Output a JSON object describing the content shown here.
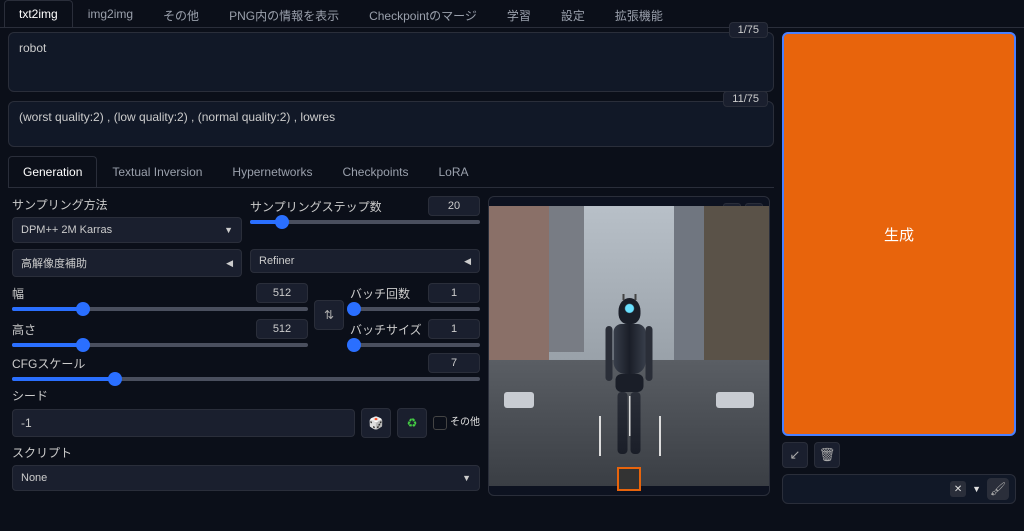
{
  "topTabs": [
    "txt2img",
    "img2img",
    "その他",
    "PNG内の情報を表示",
    "Checkpointのマージ",
    "学習",
    "設定",
    "拡張機能"
  ],
  "activeTopTab": 0,
  "prompt": {
    "text": "robot",
    "counter": "1/75"
  },
  "negPrompt": {
    "text": "(worst quality:2) , (low quality:2) , (normal quality:2) , lowres",
    "counter": "11/75"
  },
  "generateLabel": "生成",
  "subTabs": [
    "Generation",
    "Textual Inversion",
    "Hypernetworks",
    "Checkpoints",
    "LoRA"
  ],
  "activeSubTab": 0,
  "sampling": {
    "methodLabel": "サンプリング方法",
    "methodValue": "DPM++ 2M Karras",
    "stepsLabel": "サンプリングステップ数",
    "stepsValue": "20",
    "stepsPct": 14
  },
  "hires": {
    "label": "高解像度補助"
  },
  "refiner": {
    "label": "Refiner"
  },
  "width": {
    "label": "幅",
    "value": "512",
    "pct": 24
  },
  "height": {
    "label": "高さ",
    "value": "512",
    "pct": 24
  },
  "batchCount": {
    "label": "バッチ回数",
    "value": "1",
    "pct": 3
  },
  "batchSize": {
    "label": "バッチサイズ",
    "value": "1",
    "pct": 3
  },
  "cfg": {
    "label": "CFGスケール",
    "value": "7",
    "pct": 22
  },
  "seed": {
    "label": "シード",
    "value": "-1",
    "extraLabel": "その他"
  },
  "script": {
    "label": "スクリプト",
    "value": "None"
  }
}
